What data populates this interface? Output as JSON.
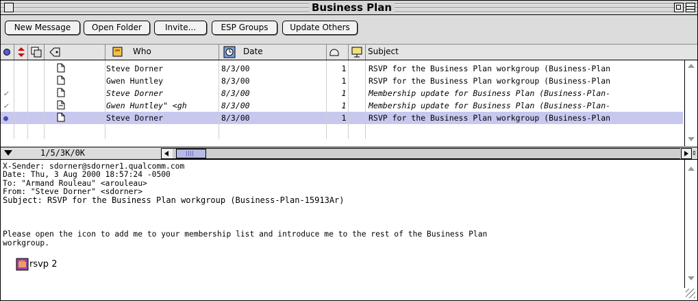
{
  "window": {
    "title": "Business Plan"
  },
  "toolbar": {
    "buttons": [
      "New Message",
      "Open Folder",
      "Invite...",
      "ESP Groups",
      "Update Others"
    ]
  },
  "columns": {
    "who": "Who",
    "date": "Date",
    "subject": "Subject"
  },
  "messages": [
    {
      "status": "",
      "who": "Steve Dorner",
      "date": "8/3/00",
      "size": "1",
      "subject": "RSVP for the Business Plan workgroup (Business-Plan",
      "italic": false,
      "selected": false
    },
    {
      "status": "",
      "who": "Gwen Huntley",
      "date": "8/3/00",
      "size": "1",
      "subject": "RSVP for the Business Plan workgroup (Business-Plan",
      "italic": false,
      "selected": false
    },
    {
      "status": "✓",
      "who": "Steve Dorner",
      "date": "8/3/00",
      "size": "1",
      "subject": "Membership update for Business Plan (Business-Plan-",
      "italic": true,
      "selected": false
    },
    {
      "status": "✓",
      "who": "Gwen Huntley\" <gh",
      "date": "8/3/00",
      "size": "1",
      "subject": "Membership update for Business Plan (Business-Plan-",
      "italic": true,
      "selected": false
    },
    {
      "status": "●",
      "who": "Steve Dorner",
      "date": "8/3/00",
      "size": "1",
      "subject": "RSVP for the Business Plan workgroup (Business-Plan",
      "italic": false,
      "selected": true
    }
  ],
  "status_bar": {
    "count": "1/5/3K/0K"
  },
  "message": {
    "headers": [
      "X-Sender: sdorner@sdorner1.qualcomm.com",
      "Date: Thu, 3 Aug 2000 18:57:24 -0500",
      "To: \"Armand Rouleau\" <arouleau>",
      "From: \"Steve Dorner\" <sdorner>",
      "Subject: RSVP for the Business Plan workgroup (Business-Plan-15913Ar)"
    ],
    "body": [
      "Please open the icon to add me to your membership list and introduce me to the rest of the Business Plan",
      "workgroup."
    ],
    "attachment": "rsvp 2"
  },
  "colors": {
    "selected_row": "#c8c8ef",
    "chrome": "#dcdcdc",
    "scroll_thumb": "#b9b9e6"
  }
}
